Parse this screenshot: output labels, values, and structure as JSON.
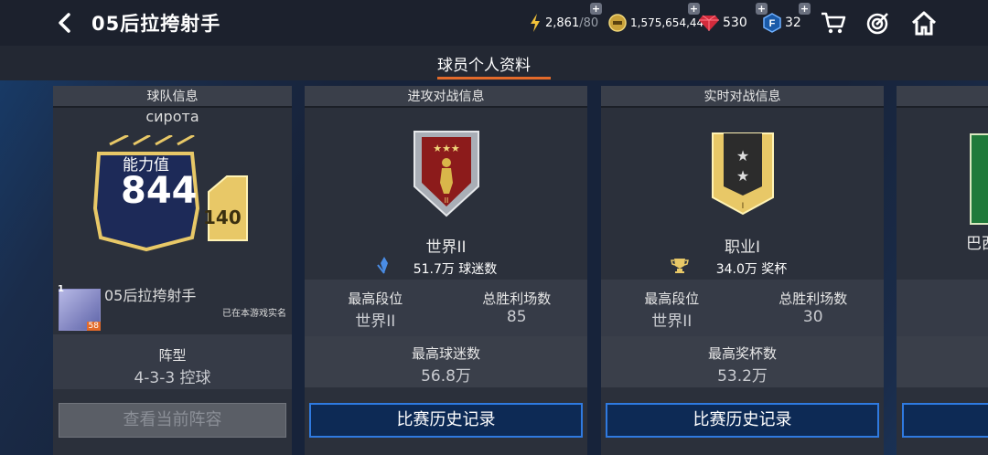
{
  "header": {
    "title": "05后拉挎射手",
    "energy": "2,861",
    "energy_max": "/80",
    "coins": "1,575,654,447",
    "gems": "530",
    "fc_points": "32"
  },
  "tabs": {
    "active": "球员个人资料"
  },
  "team_card": {
    "heading": "球队信息",
    "team_name": "сирота",
    "ovr_label": "能力值",
    "ovr_value": "844",
    "sub_value": "140",
    "player_name": "05后拉挎射手",
    "verified": "已在本游戏实名",
    "level_badge": "58",
    "rank_badge": "1",
    "formation_label": "阵型",
    "formation_value": "4-3-3 控球",
    "view_button": "查看当前阵容"
  },
  "attack_card": {
    "heading": "进攻对战信息",
    "rank_name": "世界II",
    "fans": "51.7万 球迷数",
    "best_rank_label": "最高段位",
    "best_rank_value": "世界II",
    "total_wins_label": "总胜利场数",
    "total_wins_value": "85",
    "max_fans_label": "最高球迷数",
    "max_fans_value": "56.8万",
    "history_button": "比赛历史记录"
  },
  "live_card": {
    "heading": "实时对战信息",
    "rank_name": "职业I",
    "trophies": "34.0万 奖杯",
    "best_rank_label": "最高段位",
    "best_rank_value": "世界II",
    "total_wins_label": "总胜利场数",
    "total_wins_value": "30",
    "max_trophies_label": "最高奖杯数",
    "max_trophies_value": "53.2万",
    "history_button": "比赛历史记录"
  },
  "partial_card": {
    "rank_name": "巴西"
  },
  "colors": {
    "accent_orange": "#e36a2a",
    "button_blue": "#2f7ae0",
    "gold": "#e8c867"
  }
}
